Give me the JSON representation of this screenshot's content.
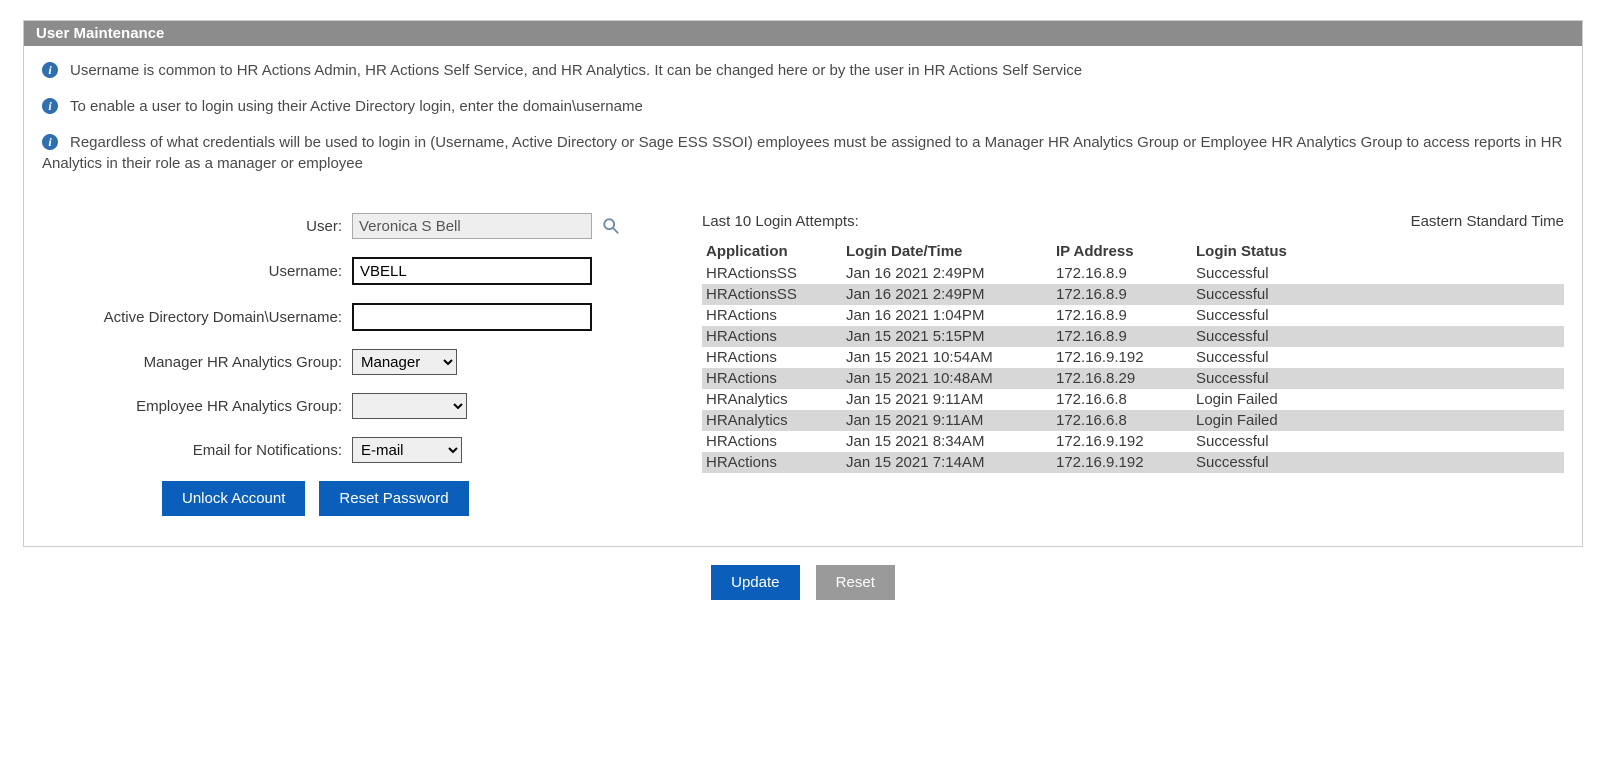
{
  "panel": {
    "title": "User Maintenance"
  },
  "info": [
    "Username is common to HR Actions Admin, HR Actions Self Service, and HR Analytics. It can be changed here or by the user in HR Actions Self Service",
    "To enable a user to login using their Active Directory login, enter the domain\\username",
    "Regardless of what credentials will be used to login in (Username, Active Directory or Sage ESS SSOI) employees must be assigned to a Manager HR Analytics Group or Employee HR Analytics Group to access reports in HR Analytics in their role as a manager or employee"
  ],
  "form": {
    "user_label": "User:",
    "user_value": "Veronica S Bell",
    "username_label": "Username:",
    "username_value": "VBELL",
    "ad_label": "Active Directory Domain\\Username:",
    "ad_value": "",
    "mgr_group_label": "Manager HR Analytics Group:",
    "mgr_group_value": "Manager",
    "emp_group_label": "Employee HR Analytics Group:",
    "emp_group_value": "",
    "email_label": "Email for Notifications:",
    "email_value": "E-mail",
    "unlock_label": "Unlock Account",
    "reset_pw_label": "Reset Password"
  },
  "attempts": {
    "heading": "Last 10 Login Attempts:",
    "timezone": "Eastern Standard Time",
    "columns": {
      "app": "Application",
      "dt": "Login Date/Time",
      "ip": "IP Address",
      "status": "Login Status"
    },
    "rows": [
      {
        "app": "HRActionsSS",
        "dt": "Jan 16 2021 2:49PM",
        "ip": "172.16.8.9",
        "status": "Successful"
      },
      {
        "app": "HRActionsSS",
        "dt": "Jan 16 2021 2:49PM",
        "ip": "172.16.8.9",
        "status": "Successful"
      },
      {
        "app": "HRActions",
        "dt": "Jan 16 2021 1:04PM",
        "ip": "172.16.8.9",
        "status": "Successful"
      },
      {
        "app": "HRActions",
        "dt": "Jan 15 2021 5:15PM",
        "ip": "172.16.8.9",
        "status": "Successful"
      },
      {
        "app": "HRActions",
        "dt": "Jan 15 2021 10:54AM",
        "ip": "172.16.9.192",
        "status": "Successful"
      },
      {
        "app": "HRActions",
        "dt": "Jan 15 2021 10:48AM",
        "ip": "172.16.8.29",
        "status": "Successful"
      },
      {
        "app": "HRAnalytics",
        "dt": "Jan 15 2021 9:11AM",
        "ip": "172.16.6.8",
        "status": "Login Failed"
      },
      {
        "app": "HRAnalytics",
        "dt": "Jan 15 2021 9:11AM",
        "ip": "172.16.6.8",
        "status": "Login Failed"
      },
      {
        "app": "HRActions",
        "dt": "Jan 15 2021 8:34AM",
        "ip": "172.16.9.192",
        "status": "Successful"
      },
      {
        "app": "HRActions",
        "dt": "Jan 15 2021 7:14AM",
        "ip": "172.16.9.192",
        "status": "Successful"
      }
    ]
  },
  "footer": {
    "update_label": "Update",
    "reset_label": "Reset"
  }
}
